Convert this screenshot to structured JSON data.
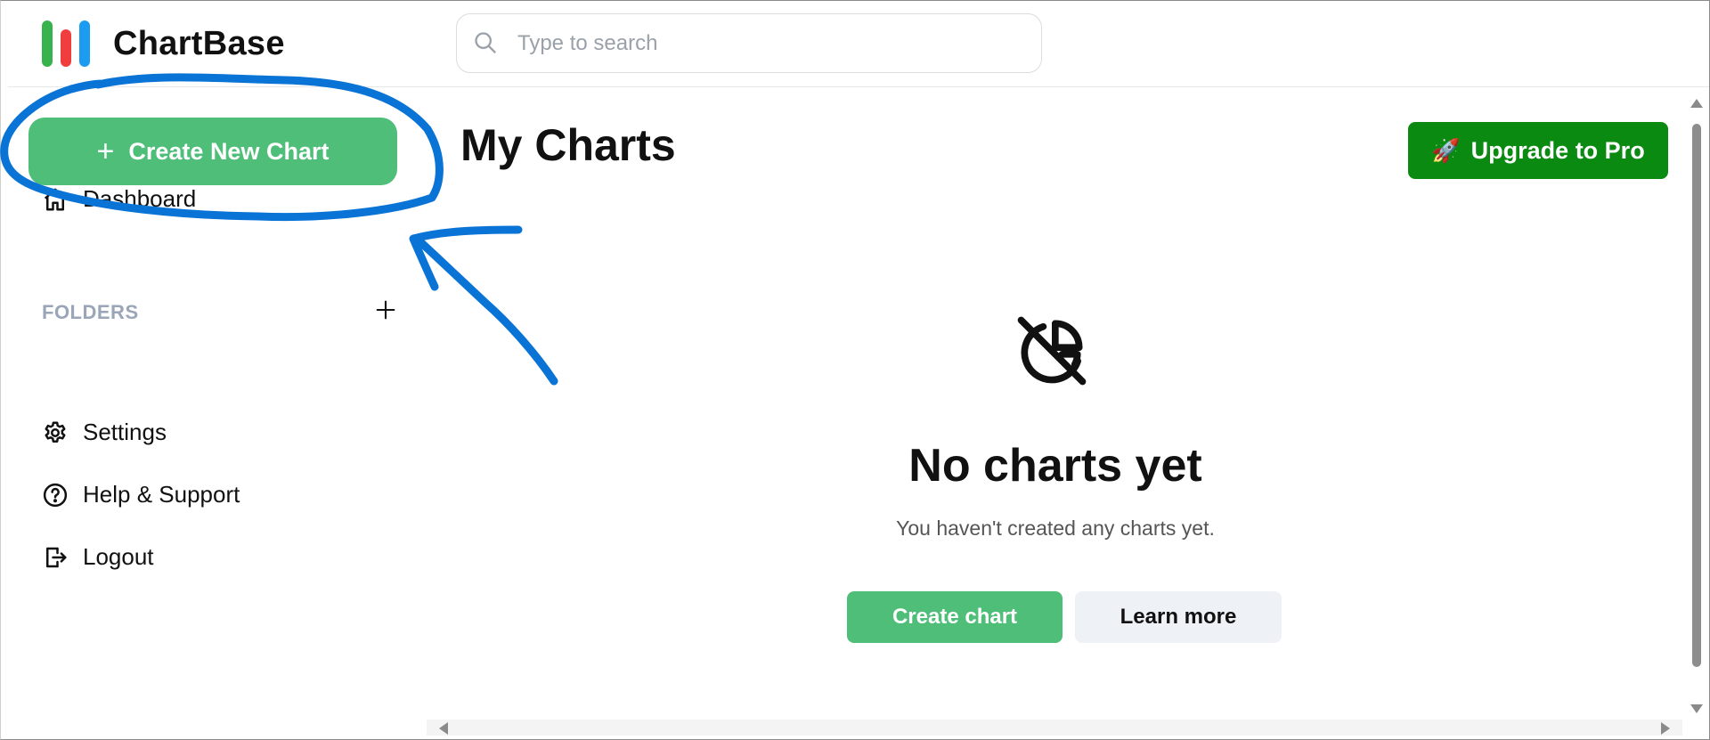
{
  "app": {
    "name": "ChartBase"
  },
  "search": {
    "placeholder": "Type to search",
    "value": ""
  },
  "sidebar": {
    "create_button": "Create New Chart",
    "items": [
      {
        "label": "Dashboard",
        "icon": "home-icon"
      },
      {
        "label": "Settings",
        "icon": "gear-icon"
      },
      {
        "label": "Help & Support",
        "icon": "help-circle-icon"
      },
      {
        "label": "Logout",
        "icon": "logout-icon"
      }
    ],
    "folders_label": "FOLDERS"
  },
  "main": {
    "title": "My Charts",
    "upgrade_button": "Upgrade to Pro",
    "upgrade_icon": "🚀",
    "empty_state": {
      "icon": "chart-pie-off-icon",
      "title": "No charts yet",
      "subtitle": "You haven't created any charts yet.",
      "primary_button": "Create chart",
      "secondary_button": "Learn more"
    }
  },
  "colors": {
    "primary_green": "#4ebe79",
    "upgrade_green": "#0b8a12",
    "annotation_blue": "#0a74d6",
    "folders_label": "#9aa6b8"
  }
}
